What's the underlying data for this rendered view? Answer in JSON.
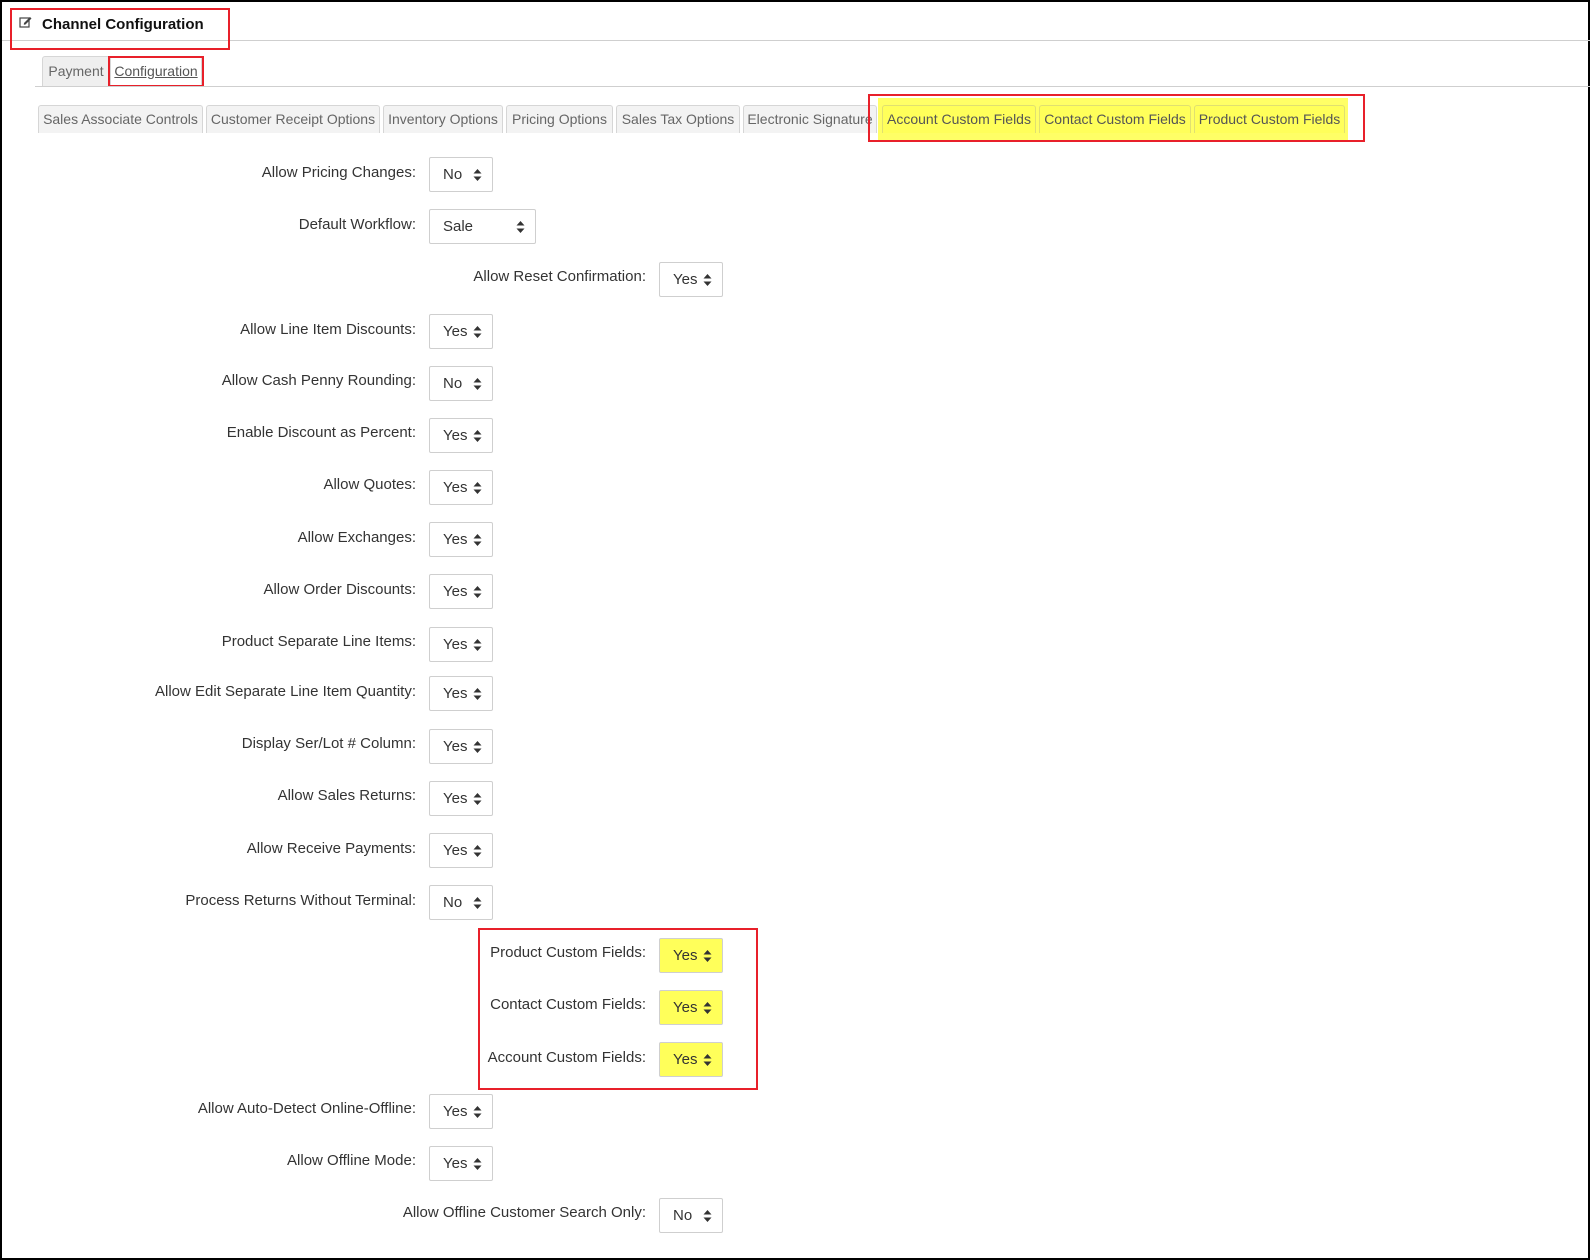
{
  "header": {
    "title": "Channel Configuration"
  },
  "top_tabs": [
    {
      "label": "Payment"
    },
    {
      "label": "Configuration"
    }
  ],
  "sub_tabs": [
    {
      "label": "Sales Associate Controls"
    },
    {
      "label": "Customer Receipt Options"
    },
    {
      "label": "Inventory Options"
    },
    {
      "label": "Pricing Options"
    },
    {
      "label": "Sales Tax Options"
    },
    {
      "label": "Electronic Signature"
    },
    {
      "label": "Account Custom Fields"
    },
    {
      "label": "Contact Custom Fields"
    },
    {
      "label": "Product Custom Fields"
    }
  ],
  "fields": [
    {
      "label": "Allow Pricing Changes:",
      "value": "No"
    },
    {
      "label": "Default Workflow:",
      "value": "Sale"
    },
    {
      "label": "Allow Reset Confirmation:",
      "value": "Yes"
    },
    {
      "label": "Allow Line Item Discounts:",
      "value": "Yes"
    },
    {
      "label": "Allow Cash Penny Rounding:",
      "value": "No"
    },
    {
      "label": "Enable Discount as Percent:",
      "value": "Yes"
    },
    {
      "label": "Allow Quotes:",
      "value": "Yes"
    },
    {
      "label": "Allow Exchanges:",
      "value": "Yes"
    },
    {
      "label": "Allow Order Discounts:",
      "value": "Yes"
    },
    {
      "label": "Product Separate Line Items:",
      "value": "Yes"
    },
    {
      "label": "Allow Edit Separate Line Item Quantity:",
      "value": "Yes"
    },
    {
      "label": "Display Ser/Lot # Column:",
      "value": "Yes"
    },
    {
      "label": "Allow Sales Returns:",
      "value": "Yes"
    },
    {
      "label": "Allow Receive Payments:",
      "value": "Yes"
    },
    {
      "label": "Process Returns Without Terminal:",
      "value": "No"
    },
    {
      "label": "Product Custom Fields:",
      "value": "Yes"
    },
    {
      "label": "Contact Custom Fields:",
      "value": "Yes"
    },
    {
      "label": "Account Custom Fields:",
      "value": "Yes"
    },
    {
      "label": "Allow Auto-Detect Online-Offline:",
      "value": "Yes"
    },
    {
      "label": "Allow Offline Mode:",
      "value": "Yes"
    },
    {
      "label": "Allow Offline Customer Search Only:",
      "value": "No"
    }
  ],
  "colors": {
    "highlight": "#ffff5a",
    "annotation_red": "#e8202a"
  }
}
